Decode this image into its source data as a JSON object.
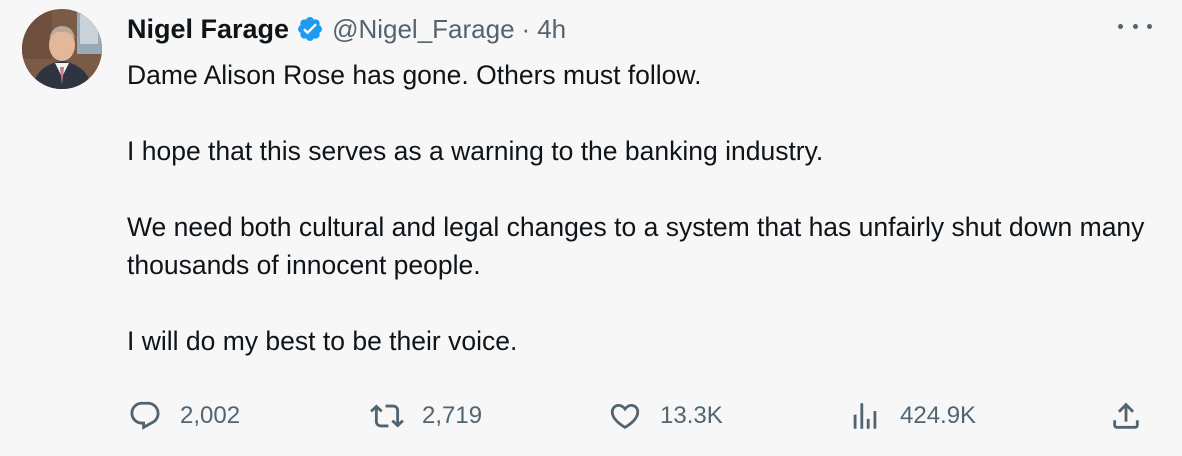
{
  "author": {
    "name": "Nigel Farage",
    "handle": "@Nigel_Farage",
    "separator": "·",
    "time": "4h",
    "verified": true
  },
  "tweet": {
    "paragraphs": [
      "Dame Alison Rose has gone. Others must follow.",
      "I hope that this serves as a warning to the banking industry.",
      "We need both cultural and legal changes to a system that has unfairly shut down many thousands of innocent people.",
      "I will do my best to be their voice."
    ]
  },
  "actions": {
    "replies": "2,002",
    "retweets": "2,719",
    "likes": "13.3K",
    "views": "424.9K"
  },
  "icons": {
    "verified": "verified-badge-icon",
    "more": "more-horizontal-icon",
    "reply": "reply-icon",
    "retweet": "retweet-icon",
    "like": "heart-icon",
    "views": "analytics-icon",
    "share": "share-icon"
  },
  "colors": {
    "background": "#f7f7f7",
    "text": "#0f1419",
    "secondary": "#536471",
    "verified": "#1d9bf0"
  }
}
